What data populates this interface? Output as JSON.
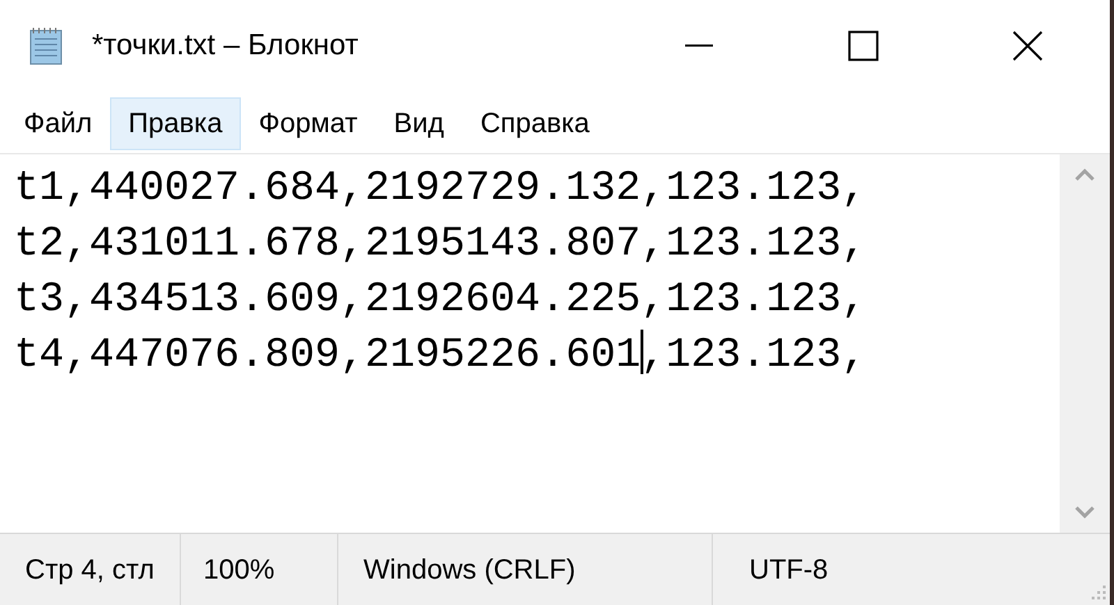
{
  "window": {
    "title": "*точки.txt – Блокнот"
  },
  "menu": [
    {
      "label": "Файл",
      "selected": false
    },
    {
      "label": "Правка",
      "selected": true
    },
    {
      "label": "Формат",
      "selected": false
    },
    {
      "label": "Вид",
      "selected": false
    },
    {
      "label": "Справка",
      "selected": false
    }
  ],
  "editor": {
    "lines": [
      {
        "kind": "plain",
        "text": "t1,440027.684,2192729.132,123.123,"
      },
      {
        "kind": "plain",
        "text": "t2,431011.678,2195143.807,123.123,"
      },
      {
        "kind": "plain",
        "text": "t3,434513.609,2192604.225,123.123,"
      },
      {
        "kind": "caret",
        "before_caret": "t4,447076.809,2195226.601",
        "after_caret": ",123.123,"
      }
    ]
  },
  "status_bar": [
    "Стр 4, стл",
    "100%",
    "Windows (CRLF)",
    "UTF-8"
  ]
}
